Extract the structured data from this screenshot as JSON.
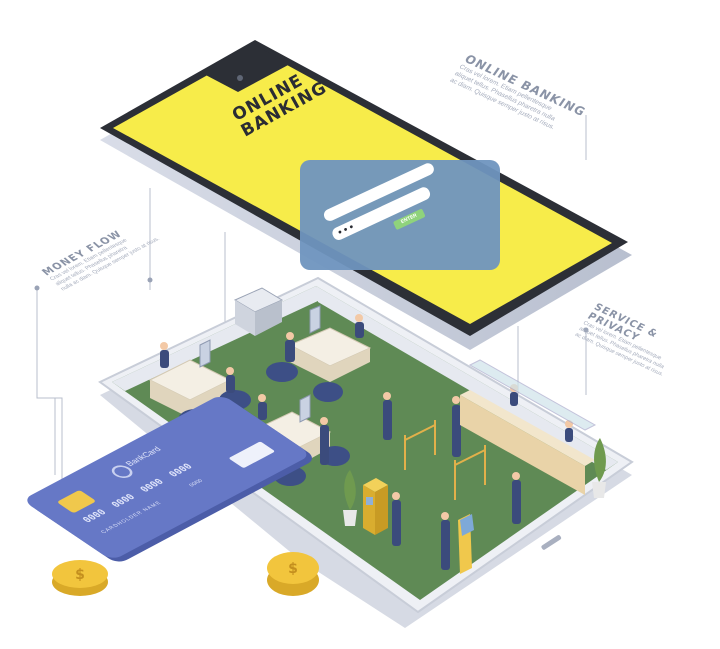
{
  "captions": {
    "online_banking": {
      "title": "ONLINE BANKING",
      "body_lines": [
        "Cras vel lorem. Etiam pellentesque",
        "aliquet tellus. Phasellus pharetra nulla",
        "ac diam. Quisque semper justo at risus."
      ]
    },
    "money_flow": {
      "title": "MONEY FLOW",
      "body_lines": [
        "Cras vel lorem. Etiam pellentesque",
        "aliquet tellus. Phasellus pharetra",
        "nulla ac diam. Quisque semper justo at risus."
      ]
    },
    "service_privacy": {
      "title_lines": [
        "SERVICE &",
        "PRIVACY"
      ],
      "body_lines": [
        "Cras vel lorem. Etiam pellentesque",
        "aliquet tellus. Phasellus pharetra nulla",
        "ac diam. Quisque semper justo at risus."
      ]
    }
  },
  "phone_screen": {
    "title_lines": [
      "ONLINE",
      "BANKING"
    ],
    "enter_button": "ENTER",
    "password_mask": "• • •"
  },
  "bank_card": {
    "brand": "BankCard",
    "number": "0000  0000  0000  0000",
    "holder": "CARDHOLDER NAME",
    "expiry": "00/00"
  },
  "colors": {
    "screen_yellow": "#f7ec4a",
    "floor_green": "#5f8a55",
    "card_blue": "#6678c6",
    "coin_gold": "#f2c53d",
    "login_panel": "#6f95bf",
    "enter_green": "#8fd37c"
  },
  "icons": [
    "dollar-coin-icon",
    "card-chip-icon",
    "bank-card-logo-icon",
    "atm-icon",
    "printer-icon",
    "computer-monitor-icon",
    "plant-icon"
  ]
}
